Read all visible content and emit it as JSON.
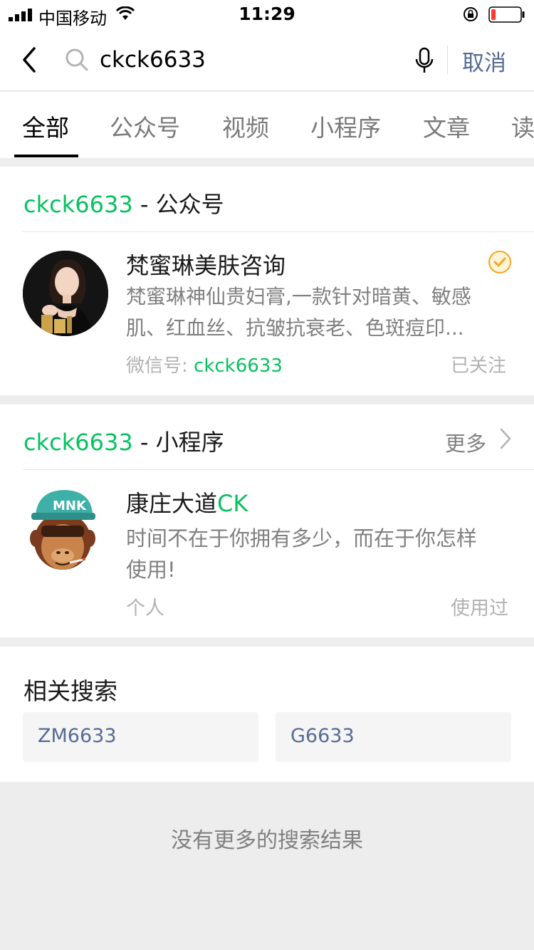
{
  "status_bar": {
    "carrier": "中国移动",
    "time": "11:29"
  },
  "search": {
    "value": "ckck6633",
    "cancel_label": "取消"
  },
  "tabs": [
    {
      "label": "全部"
    },
    {
      "label": "公众号"
    },
    {
      "label": "视频"
    },
    {
      "label": "小程序"
    },
    {
      "label": "文章"
    },
    {
      "label": "读"
    }
  ],
  "official_accounts": {
    "header_keyword": "ckck6633",
    "header_suffix": " - 公众号",
    "item": {
      "name": "梵蜜琳美肤咨询",
      "desc_line1": "梵蜜琳神仙贵妇膏,一款针对暗黄、敏感",
      "desc_line2": "肌、红血丝、抗皱抗衰老、色斑痘印...",
      "wechat_id_label": "微信号:",
      "wechat_id": "ckck6633",
      "follow_status": "已关注"
    }
  },
  "mini_programs": {
    "header_keyword": "ckck6633",
    "header_suffix": " - 小程序",
    "more_label": "更多",
    "item": {
      "name_prefix": "康庄大道",
      "name_keyword": "CK",
      "desc_line1": "时间不在于你拥有多少，而在于你怎样",
      "desc_line2": "使用!",
      "type": "个人",
      "usage_status": "使用过"
    }
  },
  "related": {
    "title": "相关搜索",
    "items": [
      "ZM6633",
      "G6633"
    ]
  },
  "footer": {
    "no_more": "没有更多的搜索结果"
  }
}
